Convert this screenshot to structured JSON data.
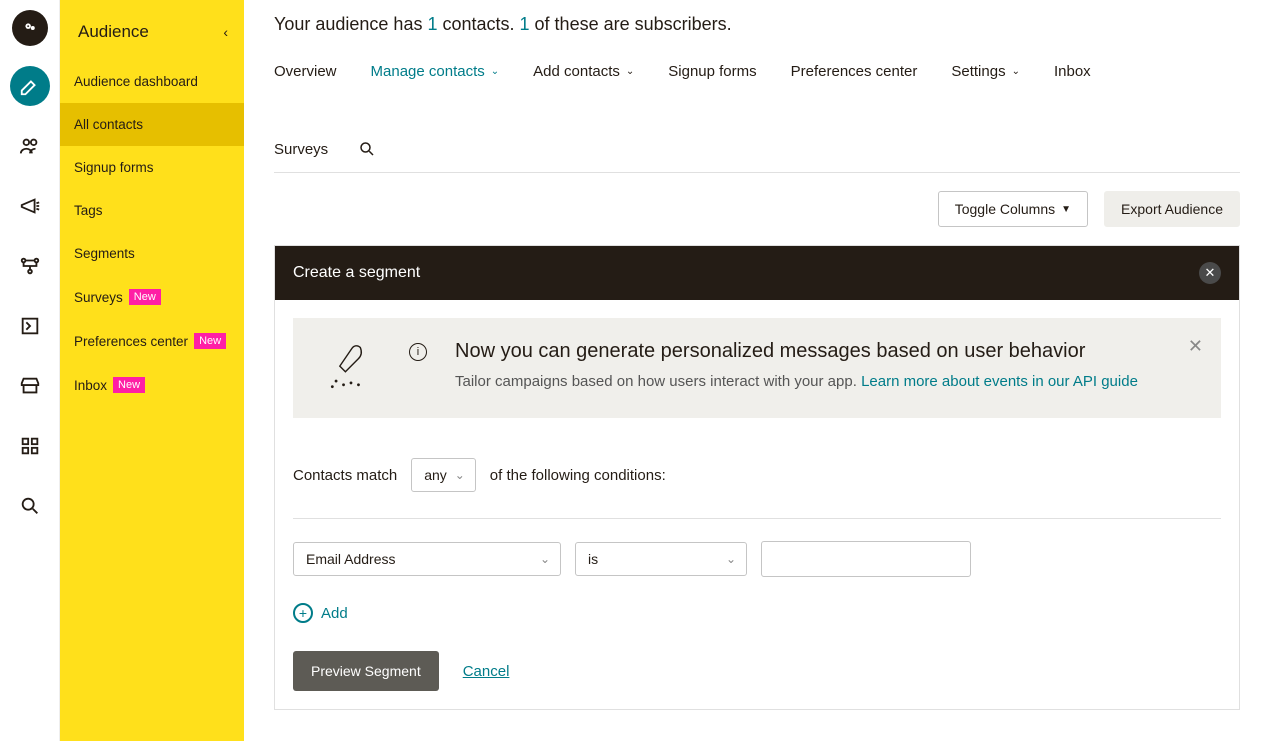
{
  "rail": {
    "icons": [
      "pencil-icon",
      "contacts-icon",
      "megaphone-icon",
      "journeys-icon",
      "page-icon",
      "store-icon",
      "apps-icon",
      "search-icon"
    ]
  },
  "sidebar": {
    "title": "Audience",
    "items": [
      {
        "label": "Audience dashboard",
        "active": false,
        "badge": null
      },
      {
        "label": "All contacts",
        "active": true,
        "badge": null
      },
      {
        "label": "Signup forms",
        "active": false,
        "badge": null
      },
      {
        "label": "Tags",
        "active": false,
        "badge": null
      },
      {
        "label": "Segments",
        "active": false,
        "badge": null
      },
      {
        "label": "Surveys",
        "active": false,
        "badge": "New"
      },
      {
        "label": "Preferences center",
        "active": false,
        "badge": "New"
      },
      {
        "label": "Inbox",
        "active": false,
        "badge": "New"
      }
    ]
  },
  "headline": {
    "prefix": "Your audience has ",
    "contacts_count": "1",
    "mid": " contacts. ",
    "subs_count": "1",
    "suffix": " of these are subscribers."
  },
  "tabs": [
    {
      "label": "Overview",
      "dropdown": false,
      "active": false
    },
    {
      "label": "Manage contacts",
      "dropdown": true,
      "active": true
    },
    {
      "label": "Add contacts",
      "dropdown": true,
      "active": false
    },
    {
      "label": "Signup forms",
      "dropdown": false,
      "active": false
    },
    {
      "label": "Preferences center",
      "dropdown": false,
      "active": false
    },
    {
      "label": "Settings",
      "dropdown": true,
      "active": false
    },
    {
      "label": "Inbox",
      "dropdown": false,
      "active": false
    },
    {
      "label": "Surveys",
      "dropdown": false,
      "active": false
    }
  ],
  "actions": {
    "toggle_columns": "Toggle Columns",
    "export_audience": "Export Audience"
  },
  "panel": {
    "title": "Create a segment",
    "info": {
      "heading": "Now you can generate personalized messages based on user behavior",
      "body": "Tailor campaigns based on how users interact with your app. ",
      "link": "Learn more about events in our API guide"
    },
    "builder": {
      "contacts_match": "Contacts match",
      "match_mode": "any",
      "conditions_suffix": "of the following conditions:",
      "field": "Email Address",
      "operator": "is",
      "value": "",
      "add_label": "Add",
      "preview_label": "Preview Segment",
      "cancel_label": "Cancel"
    }
  },
  "colors": {
    "accent": "#007c89",
    "brand_yellow": "#ffe01b",
    "badge_pink": "#ff1fa5"
  }
}
